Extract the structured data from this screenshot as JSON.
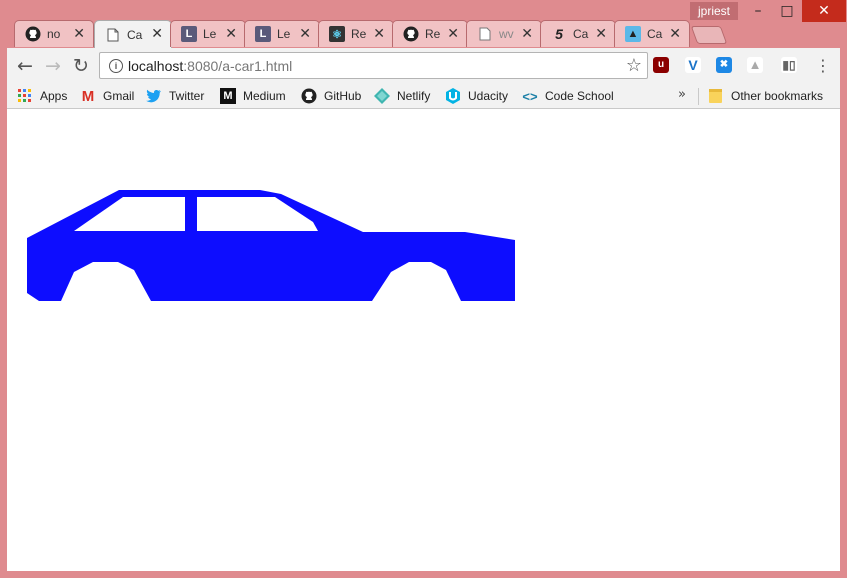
{
  "window": {
    "profile_name": "jpriest",
    "minimize_icon": "minimize-icon",
    "maximize_icon": "maximize-icon",
    "close_icon": "close-icon"
  },
  "tabs": [
    {
      "label": "no",
      "icon": "github-icon",
      "active": false
    },
    {
      "label": "Ca",
      "icon": "page-icon",
      "active": true
    },
    {
      "label": "Le",
      "icon": "lesson-icon",
      "active": false
    },
    {
      "label": "Le",
      "icon": "lesson-icon",
      "active": false
    },
    {
      "label": "Re",
      "icon": "react-icon",
      "active": false
    },
    {
      "label": "Re",
      "icon": "github-icon",
      "active": false
    },
    {
      "label": "wv",
      "icon": "page-icon",
      "active": false
    },
    {
      "label": "Ca",
      "icon": "html5-icon",
      "active": false
    },
    {
      "label": "Ca",
      "icon": "bird-icon",
      "active": false
    }
  ],
  "address_bar": {
    "host": "localhost",
    "path": ":8080/a-car1.html"
  },
  "bookmarks": [
    {
      "label": "Apps",
      "icon": "apps-grid-icon"
    },
    {
      "label": "Gmail",
      "icon": "gmail-icon"
    },
    {
      "label": "Twitter",
      "icon": "twitter-icon"
    },
    {
      "label": "Medium",
      "icon": "medium-icon"
    },
    {
      "label": "GitHub",
      "icon": "github-icon"
    },
    {
      "label": "Netlify",
      "icon": "netlify-icon"
    },
    {
      "label": "Udacity",
      "icon": "udacity-icon"
    },
    {
      "label": "Code School",
      "icon": "codeschool-icon"
    }
  ],
  "other_bookmarks": "Other bookmarks",
  "page": {
    "car_color": "#0d0dff",
    "window_color": "#ffffff"
  },
  "colors": {
    "frame": "#df8b8f",
    "toolbar": "#f2f2f2",
    "close_button": "#c42b1c"
  }
}
